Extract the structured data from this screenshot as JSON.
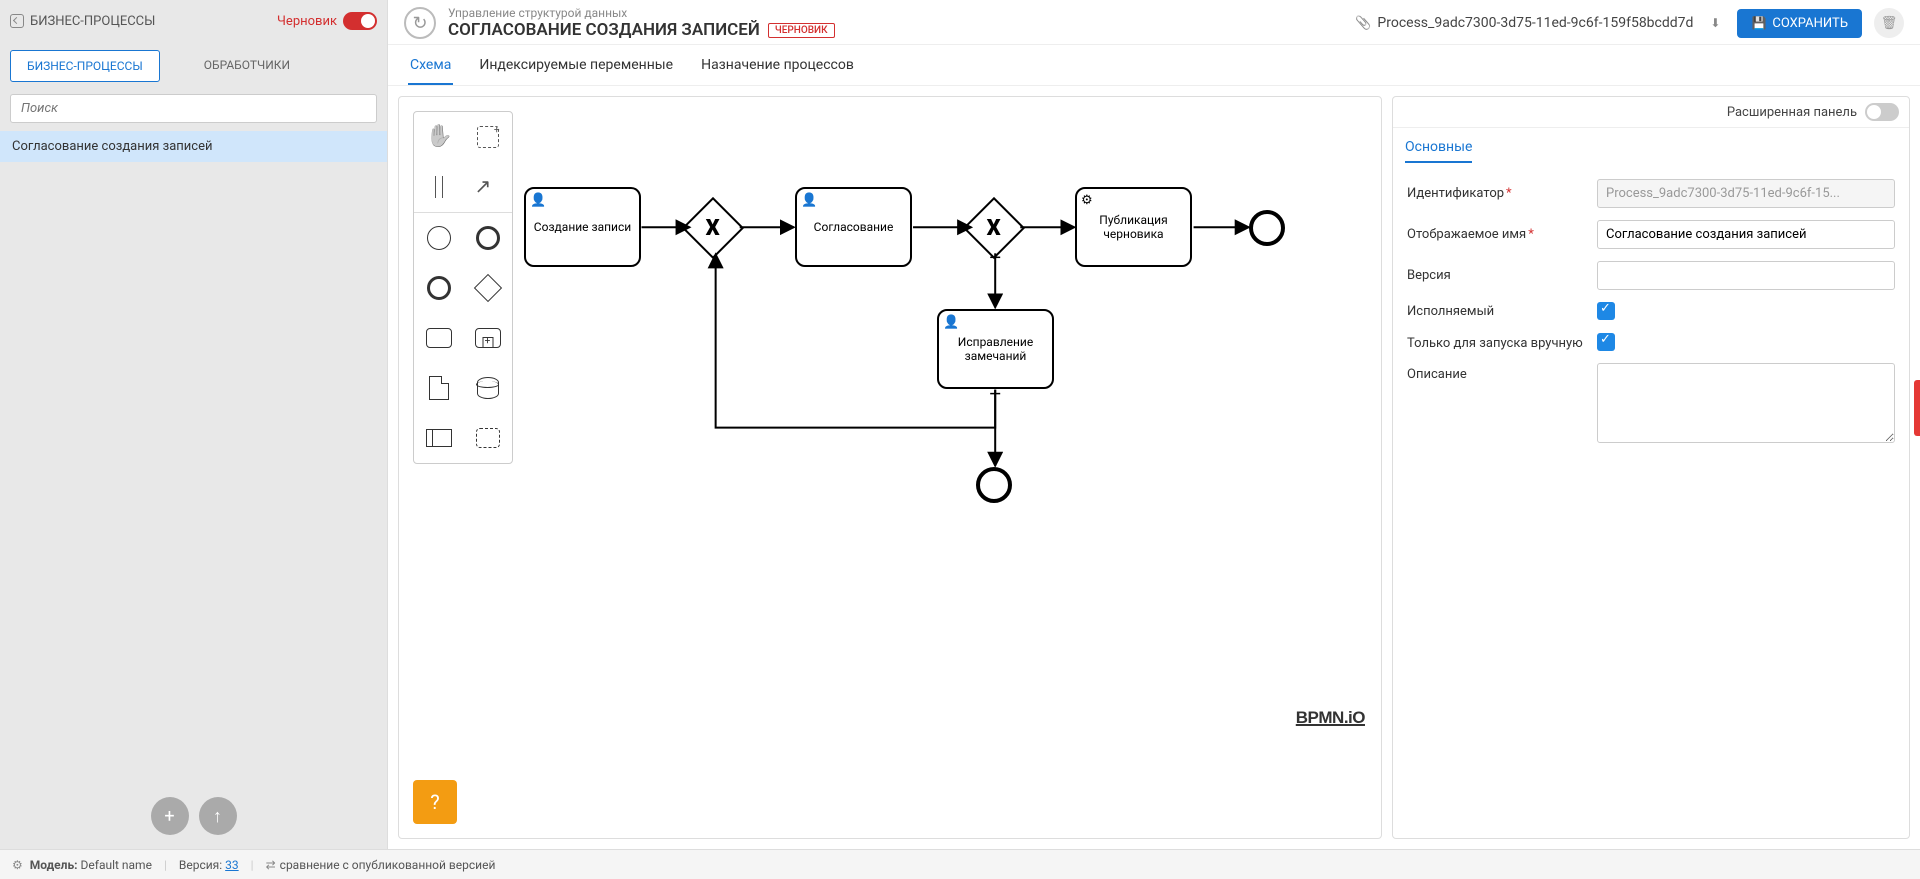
{
  "sidebar": {
    "title": "БИЗНЕС-ПРОЦЕССЫ",
    "draft_label": "Черновик",
    "tab_bp": "БИЗНЕС-ПРОЦЕССЫ",
    "tab_handlers": "ОБРАБОТЧИКИ",
    "search_placeholder": "Поиск",
    "item_selected": "Согласование создания записей",
    "add_label": "+",
    "up_label": "↑"
  },
  "header": {
    "breadcrumb": "Управление структурой данных",
    "title": "СОГЛАСОВАНИЕ СОЗДАНИЯ ЗАПИСЕЙ",
    "badge": "ЧЕРНОВИК",
    "filename": "Process_9adc7300-3d75-11ed-9c6f-159f58bcdd7d",
    "save": "СОХРАНИТЬ"
  },
  "tabs": {
    "schema": "Схема",
    "vars": "Индексируемые переменные",
    "assign": "Назначение процессов"
  },
  "bpmn": {
    "watermark": "BPMN.iO",
    "node_create": "Создание записи",
    "node_approve": "Согласование",
    "node_fix": "Исправление замечаний",
    "node_publish": "Публикация черновика",
    "help": "?"
  },
  "palette": {
    "hand": "hand-tool",
    "lasso": "lasso-tool",
    "space": "space-tool",
    "connect": "global-connect",
    "start": "start-event",
    "inter": "intermediate-event",
    "end": "end-event",
    "gateway": "gateway",
    "task": "task",
    "sub": "sub-process",
    "dataobj": "data-object",
    "datastore": "data-store",
    "pool": "participant",
    "group": "group"
  },
  "props": {
    "extended": "Расширенная панель",
    "section": "Основные",
    "lbl_id": "Идентификатор",
    "val_id": "Process_9adc7300-3d75-11ed-9c6f-15...",
    "lbl_name": "Отображаемое имя",
    "val_name": "Согласование создания записей",
    "lbl_version": "Версия",
    "val_version": "",
    "lbl_exec": "Исполняемый",
    "lbl_manual": "Только для запуска вручную",
    "lbl_desc": "Описание",
    "val_desc": ""
  },
  "status": {
    "model_label": "Модель:",
    "model_name": "Default name",
    "version_label": "Версия:",
    "version_num": "33",
    "compare": "сравнение с опубликованной версией"
  }
}
